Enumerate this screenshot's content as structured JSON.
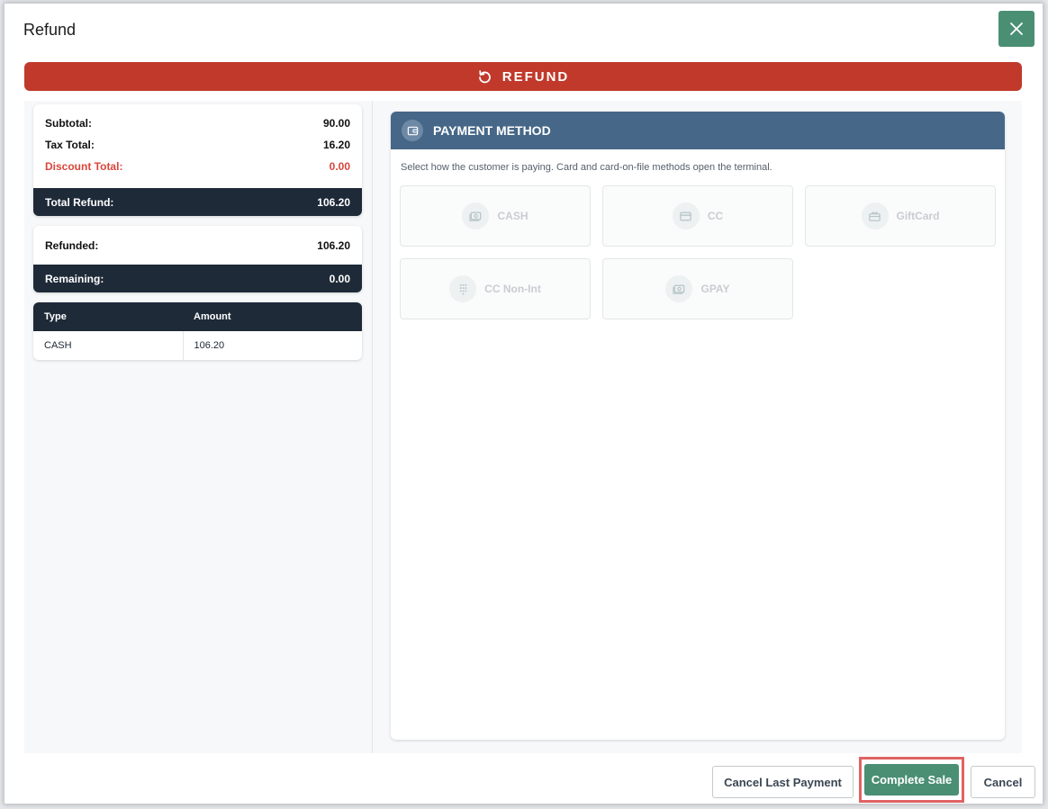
{
  "modal": {
    "title": "Refund",
    "close_icon": "close-icon"
  },
  "banner": {
    "label": "REFUND",
    "icon": "undo-icon",
    "color": "#c0392b"
  },
  "totals": {
    "subtotal_label": "Subtotal:",
    "subtotal_value": "90.00",
    "tax_label": "Tax Total:",
    "tax_value": "16.20",
    "discount_label": "Discount Total:",
    "discount_value": "0.00",
    "total_refund_label": "Total Refund:",
    "total_refund_value": "106.20"
  },
  "balance": {
    "refunded_label": "Refunded:",
    "refunded_value": "106.20",
    "remaining_label": "Remaining:",
    "remaining_value": "0.00"
  },
  "payments_table": {
    "columns": [
      "Type",
      "Amount"
    ],
    "rows": [
      {
        "type": "CASH",
        "amount": "106.20"
      }
    ]
  },
  "payment_method": {
    "title": "PAYMENT METHOD",
    "icon": "wallet-icon",
    "hint": "Select how the customer is paying. Card and card-on-file methods open the terminal.",
    "methods": [
      {
        "label": "CASH",
        "icon": "cash-icon"
      },
      {
        "label": "CC",
        "icon": "credit-card-icon"
      },
      {
        "label": "GiftCard",
        "icon": "gift-card-icon"
      },
      {
        "label": "CC Non-Int",
        "icon": "keypad-icon"
      },
      {
        "label": "GPAY",
        "icon": "cash-icon"
      }
    ]
  },
  "footer": {
    "cancel_last_label": "Cancel Last Payment",
    "complete_label": "Complete Sale",
    "cancel_label": "Cancel"
  },
  "colors": {
    "accent_green": "#4a8f73",
    "header_blue": "#466787",
    "dark_navy": "#1e2a38",
    "discount_red": "#d9453b"
  }
}
